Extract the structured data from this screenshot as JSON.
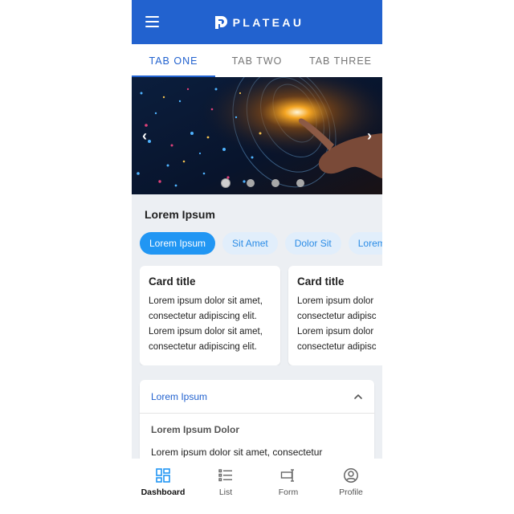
{
  "header": {
    "brand_name": "PLATEAU",
    "menu_icon": "hamburger-menu-icon",
    "logo_icon": "plateau-logo",
    "color": "#2262cf"
  },
  "tabs": [
    {
      "label": "TAB ONE",
      "active": true
    },
    {
      "label": "TAB TWO",
      "active": false
    },
    {
      "label": "TAB THREE",
      "active": false
    }
  ],
  "carousel": {
    "prev_icon": "chevron-left-icon",
    "next_icon": "chevron-right-icon",
    "slide_count": 4,
    "active_slide": 1
  },
  "section": {
    "title": "Lorem Ipsum",
    "chips": [
      {
        "label": "Lorem Ipsum",
        "active": true
      },
      {
        "label": "Sit Amet",
        "active": false
      },
      {
        "label": "Dolor Sit",
        "active": false
      },
      {
        "label": "Lorem",
        "active": false
      }
    ],
    "cards": [
      {
        "title": "Card title",
        "lines": [
          "Lorem ipsum dolor sit amet,",
          "consectetur adipiscing elit.",
          "Lorem ipsum dolor sit amet,",
          "consectetur adipiscing elit."
        ]
      },
      {
        "title": "Card title",
        "lines": [
          "Lorem ipsum dolor",
          "consectetur adipisc",
          "Lorem ipsum dolor",
          "consectetur adipisc"
        ]
      }
    ]
  },
  "accordion": {
    "title": "Lorem Ipsum",
    "subtitle": "Lorem Ipsum Dolor",
    "body": "Lorem ipsum dolor sit amet, consectetur",
    "icon": "chevron-up-icon"
  },
  "bottom_nav": [
    {
      "label": "Dashboard",
      "icon": "dashboard-icon",
      "active": true
    },
    {
      "label": "List",
      "icon": "list-icon",
      "active": false
    },
    {
      "label": "Form",
      "icon": "form-icon",
      "active": false
    },
    {
      "label": "Profile",
      "icon": "profile-icon",
      "active": false
    }
  ],
  "colors": {
    "primary": "#2262cf",
    "chip_active": "#2196f3",
    "chip_inactive_bg": "#e1eefb",
    "chip_inactive_text": "#2b8ce6",
    "background": "#eceff3"
  }
}
